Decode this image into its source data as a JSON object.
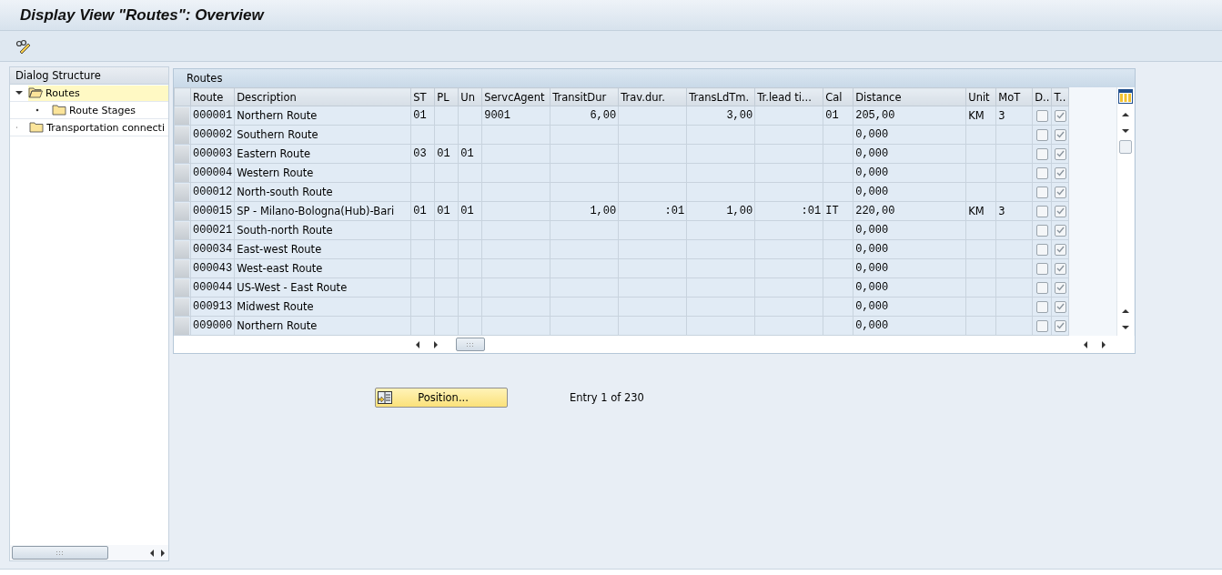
{
  "window": {
    "title": "Display View \"Routes\": Overview"
  },
  "dialog_structure": {
    "title": "Dialog Structure",
    "items": [
      {
        "label": "Routes",
        "expanded": true,
        "selected": true,
        "children": [
          {
            "label": "Route Stages",
            "expanded": false,
            "selected": false
          }
        ]
      },
      {
        "label": "Transportation connecti",
        "expanded": false,
        "selected": false
      }
    ]
  },
  "table": {
    "title": "Routes",
    "columns": [
      {
        "label": "Route",
        "kind": "mono"
      },
      {
        "label": "Description",
        "kind": "text"
      },
      {
        "label": "ST",
        "kind": "mono"
      },
      {
        "label": "PL",
        "kind": "mono"
      },
      {
        "label": "Un",
        "kind": "mono"
      },
      {
        "label": "ServcAgent",
        "kind": "mono"
      },
      {
        "label": "TransitDur",
        "kind": "number"
      },
      {
        "label": "Trav.dur.",
        "kind": "number"
      },
      {
        "label": "TransLdTm.",
        "kind": "number"
      },
      {
        "label": "Tr.lead ti...",
        "kind": "number"
      },
      {
        "label": "Cal",
        "kind": "mono"
      },
      {
        "label": "Distance",
        "kind": "mono"
      },
      {
        "label": "Unit",
        "kind": "text"
      },
      {
        "label": "MoT",
        "kind": "text"
      },
      {
        "label": "D..",
        "kind": "check"
      },
      {
        "label": "T..",
        "kind": "check"
      }
    ],
    "rows": [
      {
        "route": "000001",
        "description": "Northern Route",
        "st": "01",
        "servc_agent": "9001",
        "transit_dur": "6,00",
        "trans_ld_tm": "3,00",
        "cal": "01",
        "distance": "205,00",
        "unit": "KM",
        "mot": "3",
        "d_checked": false,
        "t_checked": true
      },
      {
        "route": "000002",
        "description": "Southern Route",
        "distance": "0,000",
        "d_checked": false,
        "t_checked": true
      },
      {
        "route": "000003",
        "description": "Eastern Route",
        "st": "03",
        "pl": "01",
        "un": "01",
        "distance": "0,000",
        "d_checked": false,
        "t_checked": true
      },
      {
        "route": "000004",
        "description": "Western Route",
        "distance": "0,000",
        "d_checked": false,
        "t_checked": true
      },
      {
        "route": "000012",
        "description": "North-south Route",
        "distance": "0,000",
        "d_checked": false,
        "t_checked": true
      },
      {
        "route": "000015",
        "description": "SP - Milano-Bologna(Hub)-Bari",
        "st": "01",
        "pl": "01",
        "un": "01",
        "transit_dur": "1,00",
        "trav_dur": ":01",
        "trans_ld_tm": "1,00",
        "tr_lead_time": ":01",
        "cal": "IT",
        "distance": "220,00",
        "unit": "KM",
        "mot": "3",
        "d_checked": false,
        "t_checked": true
      },
      {
        "route": "000021",
        "description": "South-north Route",
        "distance": "0,000",
        "d_checked": false,
        "t_checked": true
      },
      {
        "route": "000034",
        "description": "East-west Route",
        "distance": "0,000",
        "d_checked": false,
        "t_checked": true
      },
      {
        "route": "000043",
        "description": "West-east Route",
        "distance": "0,000",
        "d_checked": false,
        "t_checked": true
      },
      {
        "route": "000044",
        "description": "US-West - East Route",
        "distance": "0,000",
        "d_checked": false,
        "t_checked": true
      },
      {
        "route": "000913",
        "description": "Midwest Route",
        "distance": "0,000",
        "d_checked": false,
        "t_checked": true
      },
      {
        "route": "009000",
        "description": "Northern Route",
        "distance": "0,000",
        "d_checked": false,
        "t_checked": true
      }
    ]
  },
  "position_button": {
    "label": "Position..."
  },
  "entry_info": "Entry 1 of 230"
}
